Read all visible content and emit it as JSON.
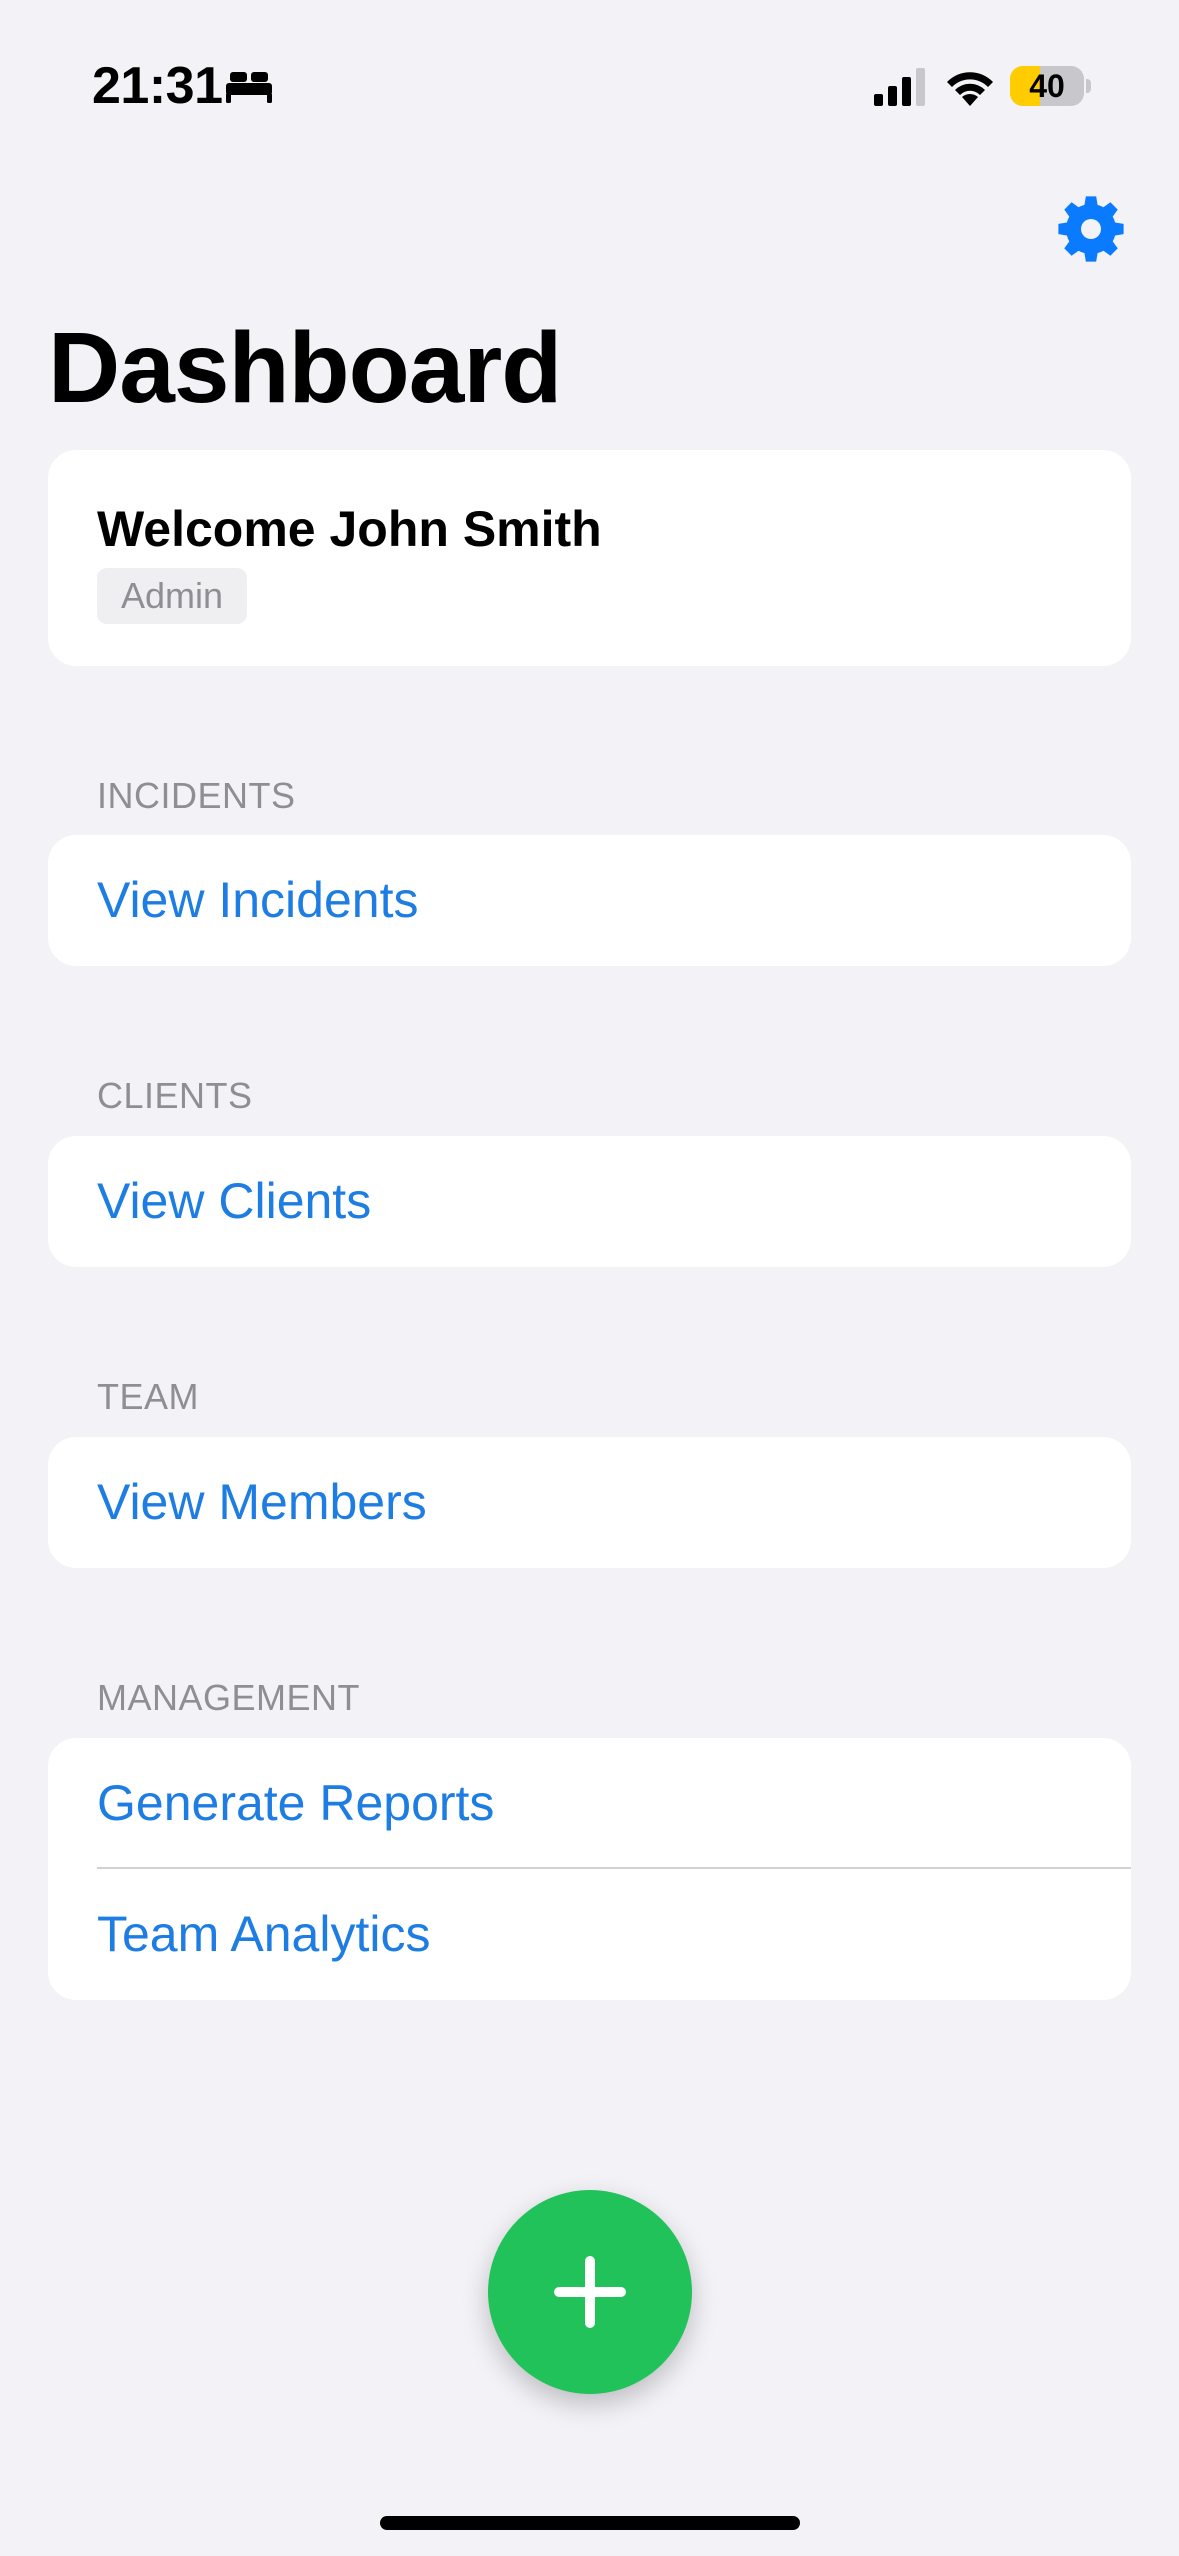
{
  "status_bar": {
    "time": "21:31",
    "focus_icon": "bed-icon",
    "battery_level": "40",
    "battery_fraction": 0.4,
    "battery_color": "#FFCC00"
  },
  "header": {
    "settings_icon": "gear-icon",
    "title": "Dashboard"
  },
  "welcome": {
    "text": "Welcome John Smith",
    "role": "Admin"
  },
  "sections": [
    {
      "header": "INCIDENTS",
      "rows": [
        "View Incidents"
      ]
    },
    {
      "header": "CLIENTS",
      "rows": [
        "View Clients"
      ]
    },
    {
      "header": "TEAM",
      "rows": [
        "View Members"
      ]
    },
    {
      "header": "MANAGEMENT",
      "rows": [
        "Generate Reports",
        "Team Analytics"
      ]
    }
  ],
  "fab": {
    "icon": "plus-icon",
    "color": "#22C25A"
  },
  "colors": {
    "background": "#F2F2F7",
    "accent": "#1E7DE3",
    "settings": "#0A7AFF",
    "secondary_text": "#8E8E93"
  }
}
